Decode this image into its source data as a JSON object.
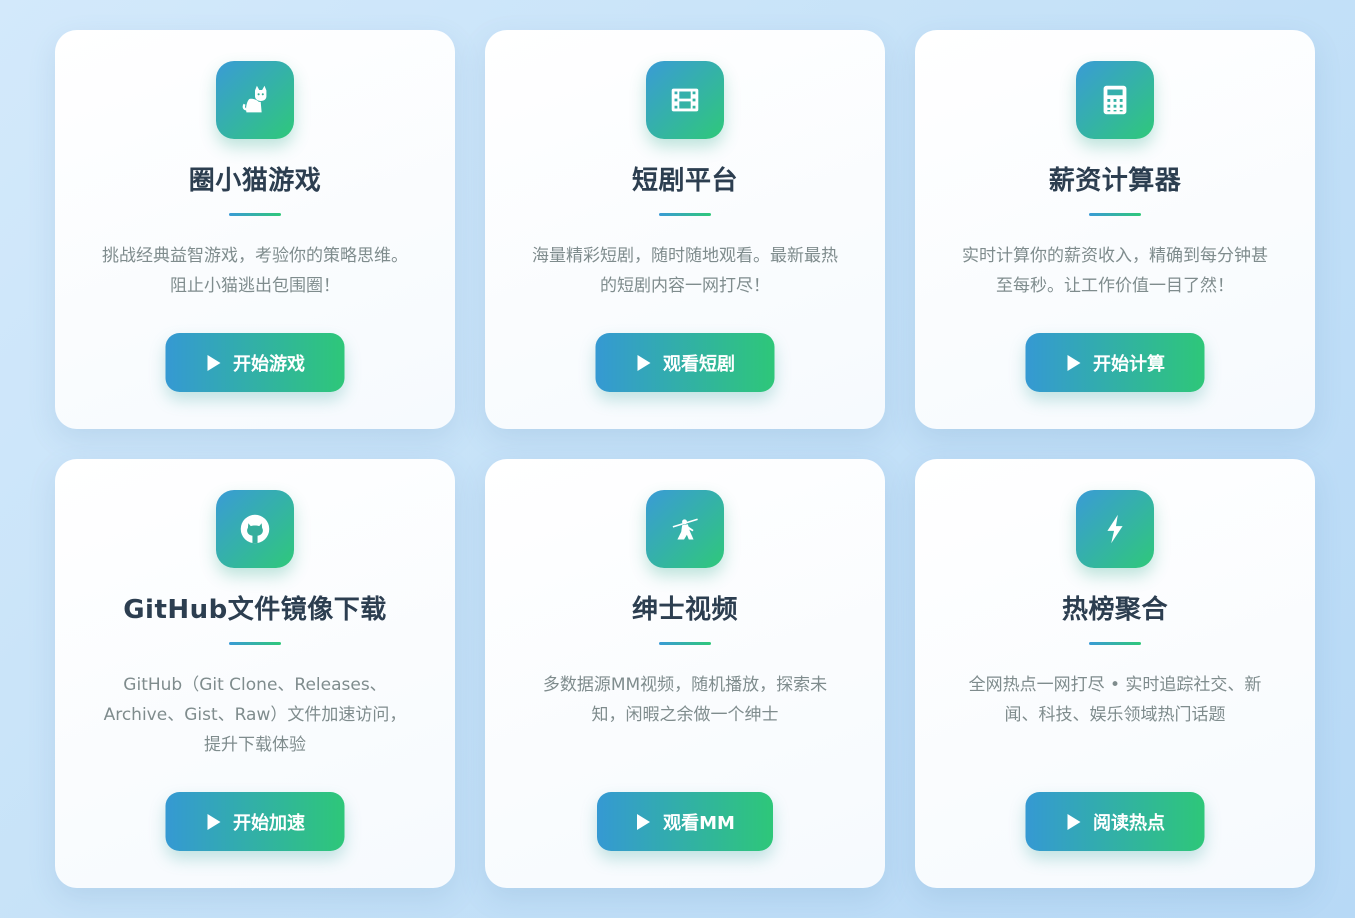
{
  "cards": [
    {
      "icon": "cat-icon",
      "title": "圈小猫游戏",
      "desc": "挑战经典益智游戏，考验你的策略思维。阻止小猫逃出包围圈！",
      "button": "开始游戏"
    },
    {
      "icon": "film-icon",
      "title": "短剧平台",
      "desc": "海量精彩短剧，随时随地观看。最新最热的短剧内容一网打尽！",
      "button": "观看短剧"
    },
    {
      "icon": "calculator-icon",
      "title": "薪资计算器",
      "desc": "实时计算你的薪资收入，精确到每分钟甚至每秒。让工作价值一目了然！",
      "button": "开始计算"
    },
    {
      "icon": "github-icon",
      "title": "GitHub文件镜像下载",
      "desc": "GitHub（Git Clone、Releases、Archive、Gist、Raw）文件加速访问，提升下载体验",
      "button": "开始加速"
    },
    {
      "icon": "dancer-icon",
      "title": "绅士视频",
      "desc": "多数据源MM视频，随机播放，探索未知，闲暇之余做一个绅士",
      "button": "观看MM"
    },
    {
      "icon": "lightning-icon",
      "title": "热榜聚合",
      "desc": "全网热点一网打尽 • 实时追踪社交、新闻、科技、娱乐领域热门话题",
      "button": "阅读热点"
    }
  ],
  "colors": {
    "gradient_start": "#3599d3",
    "gradient_end": "#2ec779",
    "title": "#2c3e50",
    "desc": "#7f8c8d"
  }
}
